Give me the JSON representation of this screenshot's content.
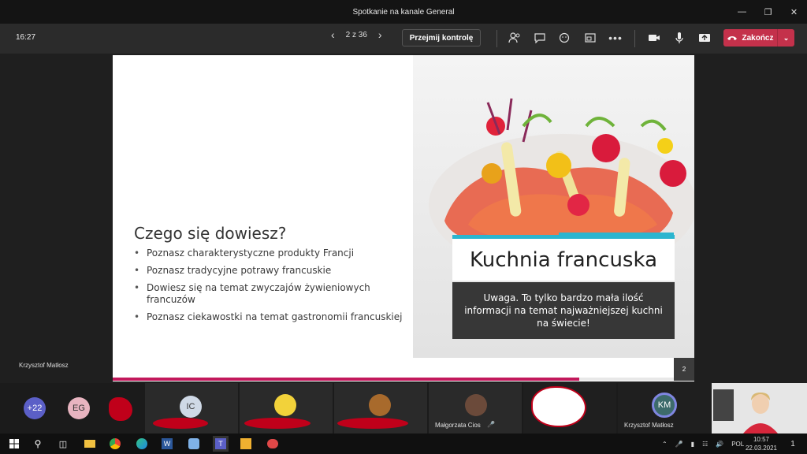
{
  "window": {
    "title": "Spotkanie na kanale General"
  },
  "toolbar": {
    "clock": "16:27",
    "page_indicator": "2 z 36",
    "take_control": "Przejmij kontrolę",
    "end_call": "Zakończ",
    "end_color": "#c4314b"
  },
  "slide": {
    "heading": "Czego się dowiesz?",
    "bullets": [
      "Poznasz charakterystyczne produkty Francji",
      "Poznasz tradycyjne potrawy francuskie",
      "Dowiesz się na temat zwyczajów żywieniowych francuzów",
      "Poznasz ciekawostki na temat gastronomii francuskiej"
    ],
    "title": "Kuchnia francuska",
    "note": "Uwaga. To tylko bardzo mała ilość informacji na temat najważniejszej kuchni na świecie!",
    "page_number": "2",
    "accent": "#2bb5cf",
    "footer_color": "#c2185b"
  },
  "presenter": {
    "name": "Krzysztof Matłosz"
  },
  "participants": {
    "overflow": "+22",
    "eg": "EG",
    "ic": "IC",
    "malgorzata": "Małgorzata Cios",
    "km": "KM",
    "krzysztof": "Krzysztof Matłosz"
  },
  "tray": {
    "lang": "POL",
    "time": "10:57",
    "date": "22.03.2021",
    "notif": "1"
  }
}
